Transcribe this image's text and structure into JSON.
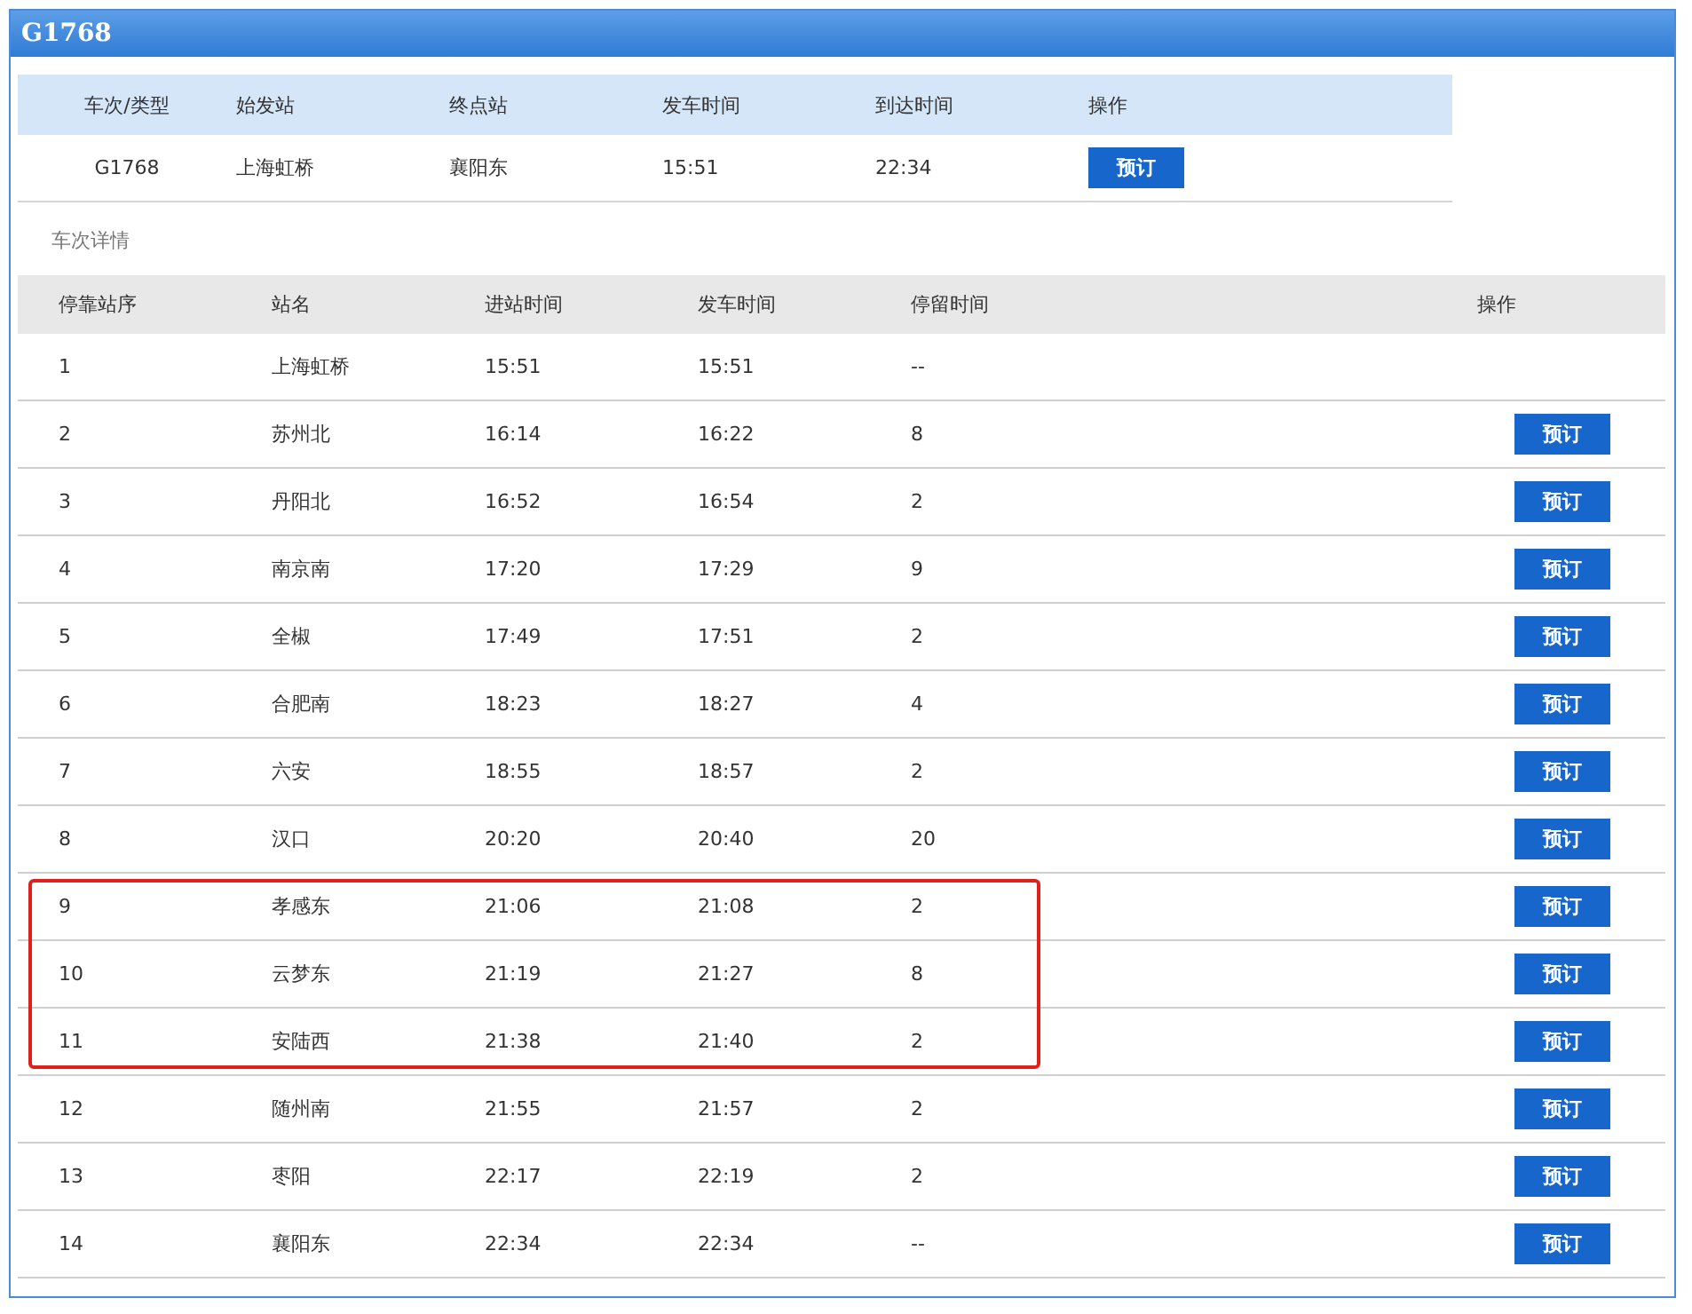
{
  "window": {
    "title": "G1768"
  },
  "summary": {
    "columns": [
      "车次/类型",
      "始发站",
      "终点站",
      "发车时间",
      "到达时间",
      "操作"
    ],
    "row": {
      "train": "G1768",
      "origin": "上海虹桥",
      "terminal": "襄阳东",
      "depart": "15:51",
      "arrive": "22:34",
      "action": "预订"
    }
  },
  "details_title": "车次详情",
  "stops_table": {
    "columns": [
      "停靠站序",
      "站名",
      "进站时间",
      "发车时间",
      "停留时间",
      "操作"
    ],
    "rows": [
      {
        "seq": "1",
        "station": "上海虹桥",
        "arrive": "15:51",
        "depart": "15:51",
        "stay": "--",
        "highlighted": false
      },
      {
        "seq": "2",
        "station": "苏州北",
        "arrive": "16:14",
        "depart": "16:22",
        "stay": "8",
        "action": "预订",
        "highlighted": false
      },
      {
        "seq": "3",
        "station": "丹阳北",
        "arrive": "16:52",
        "depart": "16:54",
        "stay": "2",
        "action": "预订",
        "highlighted": false
      },
      {
        "seq": "4",
        "station": "南京南",
        "arrive": "17:20",
        "depart": "17:29",
        "stay": "9",
        "action": "预订",
        "highlighted": false
      },
      {
        "seq": "5",
        "station": "全椒",
        "arrive": "17:49",
        "depart": "17:51",
        "stay": "2",
        "action": "预订",
        "highlighted": false
      },
      {
        "seq": "6",
        "station": "合肥南",
        "arrive": "18:23",
        "depart": "18:27",
        "stay": "4",
        "action": "预订",
        "highlighted": false
      },
      {
        "seq": "7",
        "station": "六安",
        "arrive": "18:55",
        "depart": "18:57",
        "stay": "2",
        "action": "预订",
        "highlighted": false
      },
      {
        "seq": "8",
        "station": "汉口",
        "arrive": "20:20",
        "depart": "20:40",
        "stay": "20",
        "action": "预订",
        "highlighted": false
      },
      {
        "seq": "9",
        "station": "孝感东",
        "arrive": "21:06",
        "depart": "21:08",
        "stay": "2",
        "action": "预订",
        "highlighted": true
      },
      {
        "seq": "10",
        "station": "云梦东",
        "arrive": "21:19",
        "depart": "21:27",
        "stay": "8",
        "action": "预订",
        "highlighted": true
      },
      {
        "seq": "11",
        "station": "安陆西",
        "arrive": "21:38",
        "depart": "21:40",
        "stay": "2",
        "action": "预订",
        "highlighted": true
      },
      {
        "seq": "12",
        "station": "随州南",
        "arrive": "21:55",
        "depart": "21:57",
        "stay": "2",
        "action": "预订",
        "highlighted": false
      },
      {
        "seq": "13",
        "station": "枣阳",
        "arrive": "22:17",
        "depart": "22:19",
        "stay": "2",
        "action": "预订",
        "highlighted": false
      },
      {
        "seq": "14",
        "station": "襄阳东",
        "arrive": "22:34",
        "depart": "22:34",
        "stay": "--",
        "action": "预订",
        "highlighted": false
      }
    ]
  }
}
